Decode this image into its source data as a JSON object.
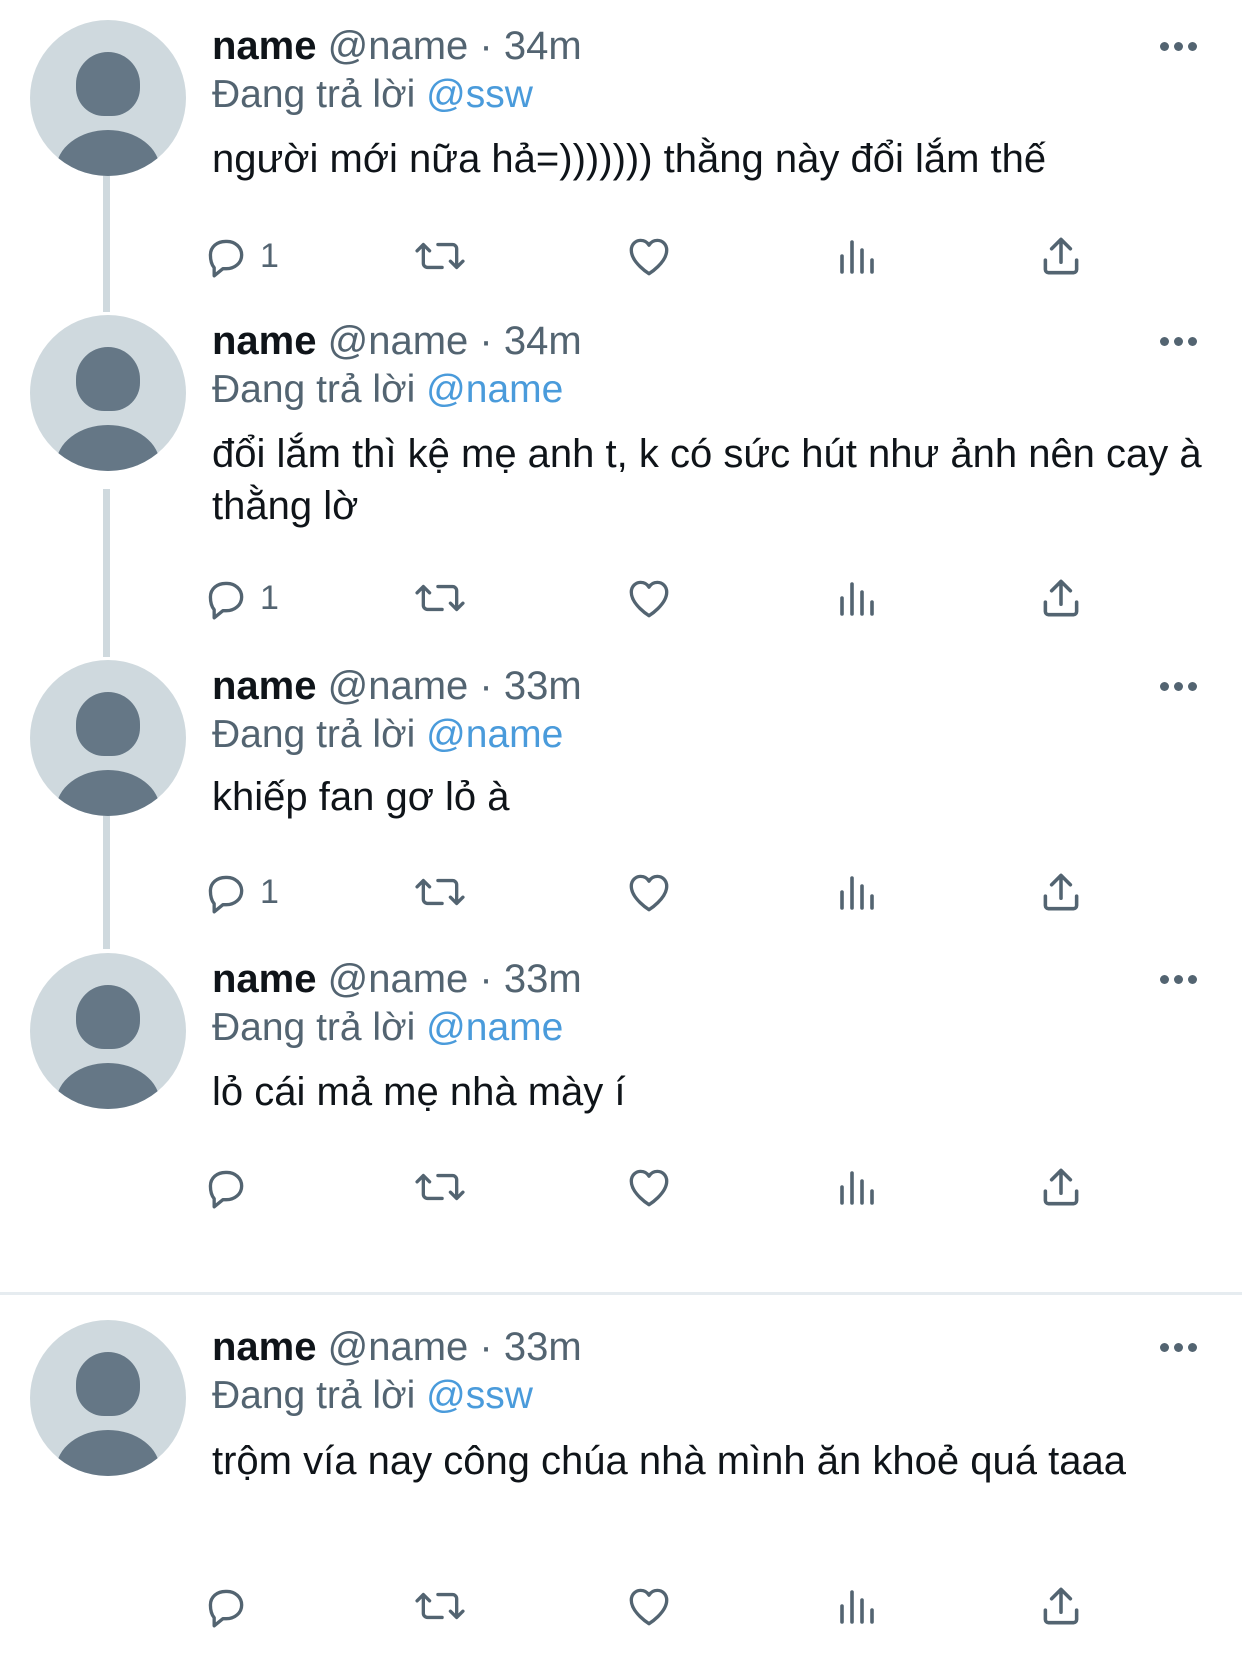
{
  "colors": {
    "text": "#0f1419",
    "secondary": "#536471",
    "mention": "#4a9bdb",
    "avatar_bg": "#cfd9de",
    "avatar_fg": "#657786"
  },
  "tweets": [
    {
      "name": "name",
      "handle": "@name",
      "separator": "·",
      "time": "34m",
      "reply_prefix": "Đang trả lời",
      "reply_to": "@ssw",
      "text": "người mới nữa hả=))))))) thằng này đổi lắm thế",
      "reply_count": "1"
    },
    {
      "name": "name",
      "handle": "@name",
      "separator": "·",
      "time": "34m",
      "reply_prefix": "Đang trả lời",
      "reply_to": "@name",
      "text": "đổi lắm thì kệ mẹ anh t, k có sức hút như ảnh nên cay à thằng lờ",
      "reply_count": "1"
    },
    {
      "name": "name",
      "handle": "@name",
      "separator": "·",
      "time": "33m",
      "reply_prefix": "Đang trả lời",
      "reply_to": "@name",
      "text": "khiếp fan gơ lỏ à",
      "reply_count": "1"
    },
    {
      "name": "name",
      "handle": "@name",
      "separator": "·",
      "time": "33m",
      "reply_prefix": "Đang trả lời",
      "reply_to": "@name",
      "text": "lỏ cái mả mẹ nhà mày í",
      "reply_count": ""
    },
    {
      "name": "name",
      "handle": "@name",
      "separator": "·",
      "time": "33m",
      "reply_prefix": "Đang trả lời",
      "reply_to": "@ssw",
      "text": "trộm vía nay công chúa nhà mình ăn khoẻ quá taaa",
      "reply_count": ""
    }
  ],
  "icons": {
    "reply": "reply-bubble-icon",
    "retweet": "retweet-icon",
    "like": "heart-icon",
    "views": "bar-chart-icon",
    "share": "share-upload-icon",
    "more": "more-horizontal-icon"
  }
}
